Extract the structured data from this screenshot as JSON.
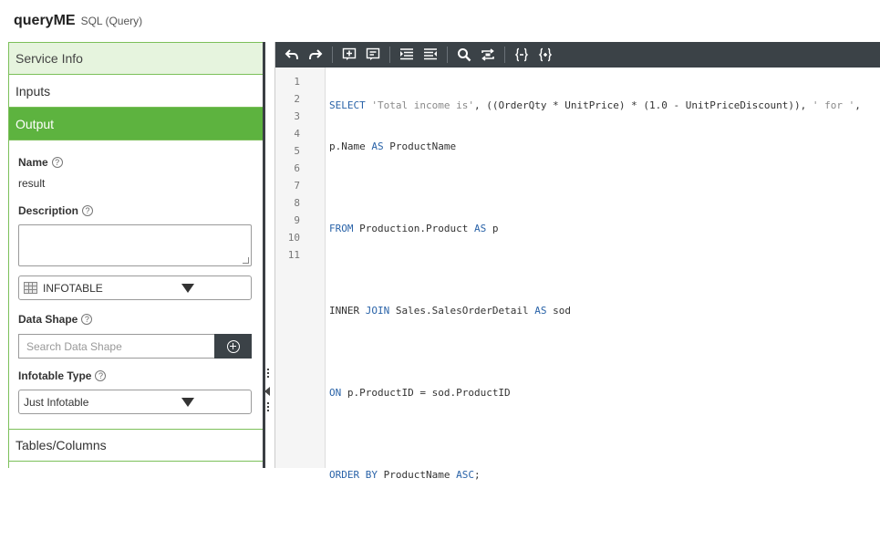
{
  "header": {
    "title": "queryME",
    "subtitle": "SQL (Query)"
  },
  "left": {
    "sections": {
      "service_info": "Service Info",
      "inputs": "Inputs",
      "output": "Output",
      "tables_columns": "Tables/Columns"
    },
    "output": {
      "name_label": "Name",
      "name_value": "result",
      "description_label": "Description",
      "base_type": "INFOTABLE",
      "data_shape_label": "Data Shape",
      "data_shape_placeholder": "Search Data Shape",
      "infotable_type_label": "Infotable Type",
      "infotable_type_value": "Just Infotable"
    },
    "help_glyph": "?"
  },
  "toolbar": {
    "icons": [
      "undo-icon",
      "redo-icon",
      "insert-snippet-icon",
      "add-comment-icon",
      "indent-left-icon",
      "indent-right-icon",
      "search-icon",
      "replace-icon",
      "collapse-braces-icon",
      "expand-braces-icon"
    ]
  },
  "editor": {
    "line_numbers": [
      "1",
      "2",
      "3",
      "4",
      "5",
      "6",
      "7",
      "8",
      "9",
      "10",
      "11"
    ]
  }
}
